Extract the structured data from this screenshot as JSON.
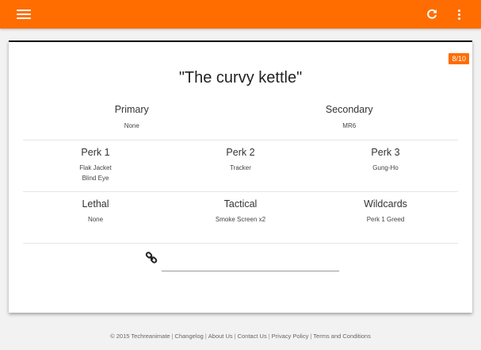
{
  "appbar": {
    "menu_icon": "hamburger-menu-icon",
    "refresh_icon": "refresh-icon",
    "more_icon": "more-vertical-icon",
    "color": "#ff6d00"
  },
  "card": {
    "badge": "8/10",
    "title": "\"The curvy kettle\"",
    "primary": {
      "label": "Primary",
      "value": "None"
    },
    "secondary": {
      "label": "Secondary",
      "value": "MR6"
    },
    "perk1": {
      "label": "Perk 1",
      "values": [
        "Flak Jacket",
        "Blind Eye"
      ]
    },
    "perk2": {
      "label": "Perk 2",
      "values": [
        "Tracker"
      ]
    },
    "perk3": {
      "label": "Perk 3",
      "values": [
        "Gung-Ho"
      ]
    },
    "lethal": {
      "label": "Lethal",
      "value": "None"
    },
    "tactical": {
      "label": "Tactical",
      "value": "Smoke Screen x2"
    },
    "wildcards": {
      "label": "Wildcards",
      "value": "Perk 1 Greed"
    },
    "share_link": {
      "icon": "link-icon",
      "value": ""
    }
  },
  "footer": {
    "copyright": "© 2015 Techreanimate",
    "links": [
      "Changelog",
      "About Us",
      "Contact Us",
      "Privacy Policy",
      "Terms and Conditions"
    ]
  }
}
